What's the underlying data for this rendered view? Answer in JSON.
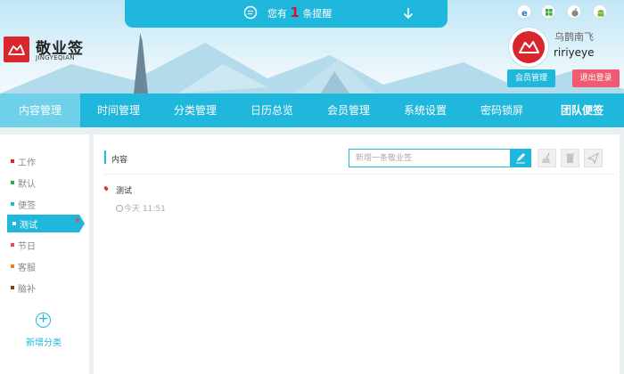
{
  "reminder": {
    "prefix": "您有",
    "count": "1",
    "suffix": "条提醒"
  },
  "brand": {
    "name": "敬业签",
    "sub": "JINGYEQIAN"
  },
  "os_icons": [
    "ie-icon",
    "windows-icon",
    "apple-icon",
    "android-icon"
  ],
  "user": {
    "name": "乌鹊南飞",
    "id": "ririyeye",
    "member_btn": "会员管理",
    "logout_btn": "退出登录"
  },
  "nav": [
    {
      "label": "内容管理",
      "active": true
    },
    {
      "label": "时间管理"
    },
    {
      "label": "分类管理"
    },
    {
      "label": "日历总览"
    },
    {
      "label": "会员管理"
    },
    {
      "label": "系统设置"
    },
    {
      "label": "密码锁屏"
    },
    {
      "label": "团队便签"
    }
  ],
  "categories": [
    {
      "label": "工作",
      "color": "#d9262d"
    },
    {
      "label": "默认",
      "color": "#2fa84f"
    },
    {
      "label": "便签",
      "color": "#1fb7dc"
    },
    {
      "label": "测试",
      "color": "#1fb7dc",
      "active": true
    },
    {
      "label": "节日",
      "color": "#f0455e"
    },
    {
      "label": "客服",
      "color": "#f07a2a"
    },
    {
      "label": "脑补",
      "color": "#8b3a1a"
    }
  ],
  "add_category": "新增分类",
  "content": {
    "section_title": "内容",
    "new_placeholder": "新增一条敬业签",
    "notes": [
      {
        "title": "测试",
        "time": "今天 11:51"
      }
    ]
  },
  "colors": {
    "accent": "#1fb7dc",
    "brand_red": "#d9262d",
    "logout": "#f05a72"
  }
}
